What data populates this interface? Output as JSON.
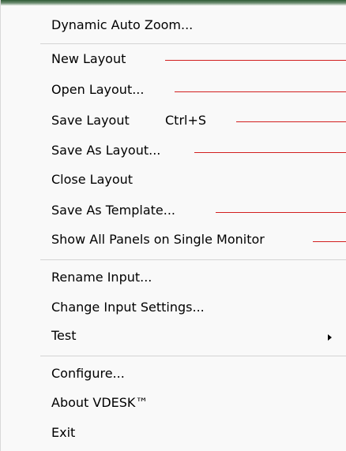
{
  "menu": {
    "items": [
      {
        "label": "Dynamic Auto Zoom..."
      },
      {
        "label": "New Layout"
      },
      {
        "label": "Open Layout..."
      },
      {
        "label": "Save Layout",
        "shortcut": "Ctrl+S"
      },
      {
        "label": "Save As Layout..."
      },
      {
        "label": "Close Layout"
      },
      {
        "label": "Save As Template..."
      },
      {
        "label": "Show All Panels on Single Monitor"
      },
      {
        "label": "Rename Input..."
      },
      {
        "label": "Change Input Settings..."
      },
      {
        "label": "Test",
        "has_submenu": true
      },
      {
        "label": "Configure..."
      },
      {
        "label": "About VDESK™"
      },
      {
        "label": "Exit"
      }
    ]
  },
  "colors": {
    "menu_background": "#f9f9f9",
    "separator": "#d4d4d4",
    "annotation_line": "#d21f1f",
    "top_strip": "#2e5a35"
  }
}
